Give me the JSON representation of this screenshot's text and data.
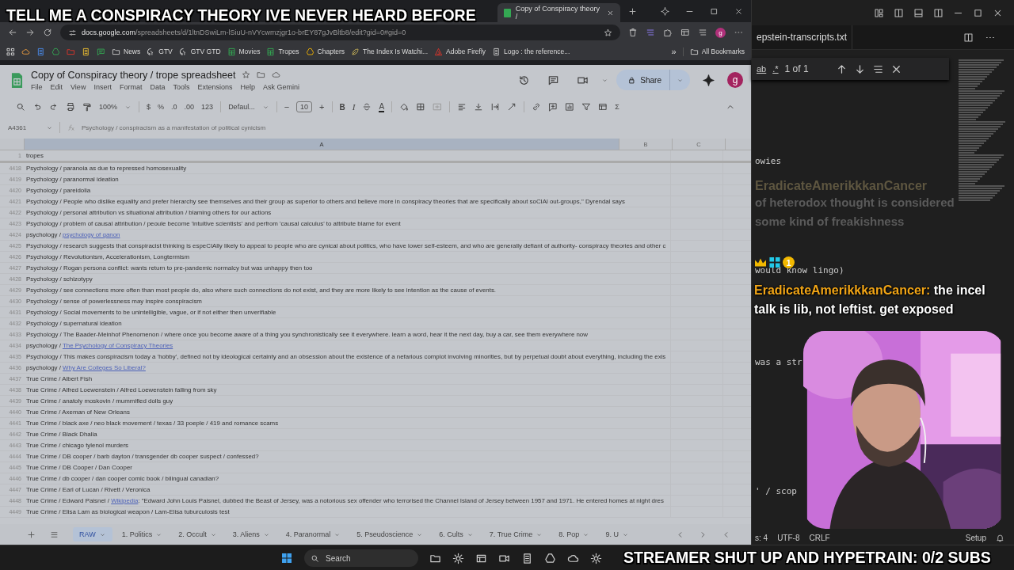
{
  "stream_overlay": {
    "title": "TELL ME A CONSPIRACY THEORY IVE NEVER HEARD BEFORE",
    "hype": "STREAMER SHUT UP AND HYPETRAIN: 0/2 SUBS"
  },
  "browser": {
    "tabs": [
      {
        "title": "Copy of Conspiracy theory /",
        "selected": true
      }
    ],
    "url_host": "docs.google.com",
    "url_path": "/spreadsheets/d/1ltnDSwiLm-lSiuU-nVYcwmzjgr1o-brEY87gJvBltb8/edit?gid=0#gid=0",
    "bookmarks": [
      {
        "label": "News",
        "kind": "folder"
      },
      {
        "label": "GTV",
        "kind": "github"
      },
      {
        "label": "GTV GTD",
        "kind": "github"
      },
      {
        "label": "Movies",
        "kind": "sheet"
      },
      {
        "label": "Tropes",
        "kind": "sheet"
      },
      {
        "label": "Chapters",
        "kind": "drive"
      },
      {
        "label": "The Index Is Watchi...",
        "kind": "leaf"
      },
      {
        "label": "Adobe Firefly",
        "kind": "adobe"
      },
      {
        "label": "Logo : the reference...",
        "kind": "page"
      }
    ],
    "avatar": "g",
    "more": "»",
    "all_bookmarks": "All Bookmarks"
  },
  "sheet": {
    "title": "Copy of Conspiracy theory / trope spreadsheet",
    "menus": [
      "File",
      "Edit",
      "View",
      "Insert",
      "Format",
      "Data",
      "Tools",
      "Extensions",
      "Help",
      "Ask Gemini"
    ],
    "share": "Share",
    "avatar": "g",
    "toolbar": {
      "zoom": "100%",
      "formats": [
        "$",
        "%",
        ".0",
        ".00",
        "123"
      ],
      "font": "Defaul...",
      "size_minus": "−",
      "size": "10",
      "size_plus": "+",
      "bold": "B",
      "italic": "I",
      "text_color": "A",
      "sum": "Σ"
    },
    "name_box": "A4361",
    "formula": "Psychology / conspiracism as a manifestation of political cynicism",
    "columns": [
      {
        "label": "A",
        "selected": true
      },
      {
        "label": "B",
        "selected": false
      },
      {
        "label": "C",
        "selected": false
      }
    ],
    "header_row": {
      "number": "1",
      "text": "tropes"
    },
    "rows": [
      {
        "number": "4418",
        "text": "Psychology / paranoia as due to repressed homosexuality"
      },
      {
        "number": "4419",
        "text": "Psychology / paranormal ideation"
      },
      {
        "number": "4420",
        "text": "Psychology / pareidolia"
      },
      {
        "number": "4421",
        "text": "Psychology / People who dislike equality and prefer hierarchy see themselves and their group as superior to others and believe more in conspiracy theories that are specifically about soCIAl out-groups,\" Dyrendal says"
      },
      {
        "number": "4422",
        "text": "Psychology / personal attribution vs situational attribution / blaming others for our actions"
      },
      {
        "number": "4423",
        "text": "Psychology / problem of causal attribution / peoule become 'intuitive scientists' and perfrom 'causal calculus' to attribute blame for event"
      },
      {
        "number": "4424",
        "text": "psychology / ",
        "link": "psychology of qanon"
      },
      {
        "number": "4425",
        "text": "Psychology / research suggests that conspiracist thinking is espeCIAlly likely to appeal to people who are cynical about politics, who have lower self-esteem, and who are generally defiant of authority- conspiracy theories and other c"
      },
      {
        "number": "4426",
        "text": "Psychology / Revolutionism, Accelerationism, Longtermism"
      },
      {
        "number": "4427",
        "text": "Psychology / Rogan persona conflict: wants return to pre-pandemic normalcy but was unhappy then too"
      },
      {
        "number": "4428",
        "text": "Psychology / schizotypy"
      },
      {
        "number": "4429",
        "text": "Psychology / see connections more often than most people do, also where such connections do not exist, and they are more likely to see intention as the cause of events."
      },
      {
        "number": "4430",
        "text": "Psychology / sense of powerlessness may inspire conspiracism"
      },
      {
        "number": "4431",
        "text": "Psychology / Social movements to be unintelligible, vague, or if not either then unverifiable"
      },
      {
        "number": "4432",
        "text": "Psychology / supernatural ideation"
      },
      {
        "number": "4433",
        "text": "Psychology / The Baader-Meinhof Phenomenon / where once you become aware of a thing you synchronistically see it everywhere. learn a word, hear it the next day, buy a car, see them everywhere now"
      },
      {
        "number": "4434",
        "text": "psychology / ",
        "link": "The Psychology of Conspiracy Theories"
      },
      {
        "number": "4435",
        "text": "Psychology / This makes conspiracism today a 'hobby', defined not by ideological certainty and an obsession about the existence of a nefarious complot involving minorities, but by perpetual doubt about everything, including the exis"
      },
      {
        "number": "4436",
        "text": "psychology / ",
        "link": "Why Are Colleges So Liberal?"
      },
      {
        "number": "4437",
        "text": "True Crime / Albert Fish"
      },
      {
        "number": "4438",
        "text": "True Crime / Alfred Loewenstein / Alfred Loewenstein falling from sky"
      },
      {
        "number": "4439",
        "text": "True Crime / anatoly moskovin / mummified dolls guy"
      },
      {
        "number": "4440",
        "text": "True Crime / Axeman of New Orleans"
      },
      {
        "number": "4441",
        "text": "True Crime / black axe / neo black movement / texas / 33 poeple / 419 and romance scams"
      },
      {
        "number": "4442",
        "text": "True Crime / Black Dhalia"
      },
      {
        "number": "4443",
        "text": "True Crime / chicago tylenol murders"
      },
      {
        "number": "4444",
        "text": "True Crime / DB cooper / barb dayton / transgender db cooper suspect / confessed?"
      },
      {
        "number": "4445",
        "text": "True Crime / DB Cooper / Dan Cooper"
      },
      {
        "number": "4446",
        "text": "True Crime / db cooper / dan cooper comic book / bilingual canadian?"
      },
      {
        "number": "4447",
        "text": "True Crime / Earl of Lucan / Rivett / Veronica"
      },
      {
        "number": "4448",
        "text": "True Crime / Edward Paisnel / ",
        "link": "Wikipedia",
        "rest": ": \"Edward John Louis Paisnel, dubbed the Beast of Jersey, was a notorious sex offender who terrorised the Channel Island of Jersey between 1957 and 1971. He entered homes at night dres"
      },
      {
        "number": "4449",
        "text": "True Crime / Elisa Lam as biological weapon / Lam-Elisa tuburculosis test"
      }
    ],
    "sheet_tabs": [
      {
        "label": "RAW",
        "selected": true
      },
      {
        "label": "1. Politics",
        "selected": false
      },
      {
        "label": "2. Occult",
        "selected": false
      },
      {
        "label": "3. Aliens",
        "selected": false
      },
      {
        "label": "4. Paranormal",
        "selected": false
      },
      {
        "label": "5. Pseudoscience",
        "selected": false
      },
      {
        "label": "6. Cults",
        "selected": false
      },
      {
        "label": "7. True Crime",
        "selected": false
      },
      {
        "label": "8. Pop",
        "selected": false
      },
      {
        "label": "9. U",
        "selected": false
      }
    ]
  },
  "editor": {
    "tab": "epstein-transcripts.txt",
    "find_options": [
      "ab",
      ".*"
    ],
    "find_count": "1 of 1",
    "fragments": [
      "owies",
      "would know lingo)",
      "was a str",
      "' / scop"
    ],
    "status": [
      "s: 4",
      "UTF-8",
      "CRLF",
      "Setup"
    ]
  },
  "chat": {
    "ghost_user": "EradicateAmerikkkanCancer",
    "ghost_lines": [
      "of heterodox thought is considered",
      "some kind of freakishness"
    ],
    "badge": "1",
    "user": "EradicateAmerikkkanCancer:",
    "message": "the incel talk is lib, not leftist. get exposed"
  },
  "taskbar": {
    "search": "Search"
  }
}
